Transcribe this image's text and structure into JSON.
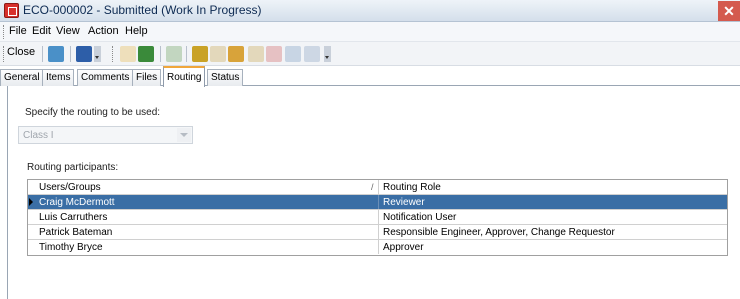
{
  "window": {
    "title": "ECO-000002 - Submitted (Work In Progress)",
    "close_glyph": "✕"
  },
  "menu": [
    "File",
    "Edit",
    "View",
    "Action",
    "Help"
  ],
  "toolbar": {
    "close_label": "Close",
    "buttons": [
      {
        "icon": "refresh-icon",
        "color": "#4a90c8",
        "enabled": true
      },
      {
        "icon": "help-icon",
        "color": "#2d5ea8",
        "enabled": true
      },
      {
        "icon": "new-document-icon",
        "color": "#e8b84a",
        "enabled": false
      },
      {
        "icon": "navigate-icon",
        "color": "#3a8a3a",
        "enabled": true
      },
      {
        "icon": "copy-icon",
        "color": "#6b9e5a",
        "enabled": false
      },
      {
        "icon": "paste-icon",
        "color": "#c9a227",
        "enabled": true
      },
      {
        "icon": "edit-icon",
        "color": "#c8a34a",
        "enabled": false
      },
      {
        "icon": "pencil-icon",
        "color": "#d8a33a",
        "enabled": true
      },
      {
        "icon": "tools-icon",
        "color": "#c8a34a",
        "enabled": false
      },
      {
        "icon": "delete-icon",
        "color": "#d06060",
        "enabled": false
      },
      {
        "icon": "check-icon",
        "color": "#7a9ac0",
        "enabled": false
      },
      {
        "icon": "grid-icon",
        "color": "#8aa0c0",
        "enabled": false
      }
    ]
  },
  "tabs": [
    "General",
    "Items",
    "Comments",
    "Files",
    "Routing",
    "Status"
  ],
  "active_tab": "Routing",
  "routing": {
    "specify_label": "Specify the routing to be used:",
    "selected_routing": "Class I",
    "participants_label": "Routing participants:",
    "columns": [
      "Users/Groups",
      "Routing Role"
    ],
    "rows": [
      {
        "user": "Craig McDermott",
        "role": "Reviewer",
        "selected": true
      },
      {
        "user": "Luis Carruthers",
        "role": "Notification User",
        "selected": false
      },
      {
        "user": "Patrick Bateman",
        "role": "Responsible Engineer, Approver, Change Requestor",
        "selected": false
      },
      {
        "user": "Timothy Bryce",
        "role": "Approver",
        "selected": false
      }
    ]
  },
  "colors": {
    "selection": "#3a6ea5",
    "active_tab_accent": "#f0a63b"
  }
}
